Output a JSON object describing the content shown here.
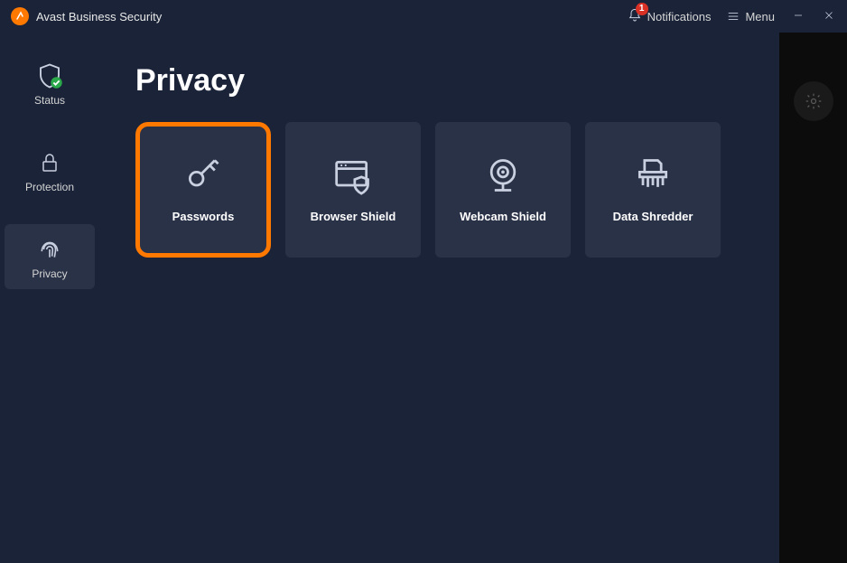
{
  "app": {
    "title": "Avast Business Security"
  },
  "header": {
    "notifications_label": "Notifications",
    "notifications_count": "1",
    "menu_label": "Menu"
  },
  "sidebar": {
    "status": "Status",
    "protection": "Protection",
    "privacy": "Privacy"
  },
  "page": {
    "title": "Privacy"
  },
  "tiles": {
    "passwords": "Passwords",
    "browser_shield": "Browser Shield",
    "webcam_shield": "Webcam Shield",
    "data_shredder": "Data Shredder"
  }
}
